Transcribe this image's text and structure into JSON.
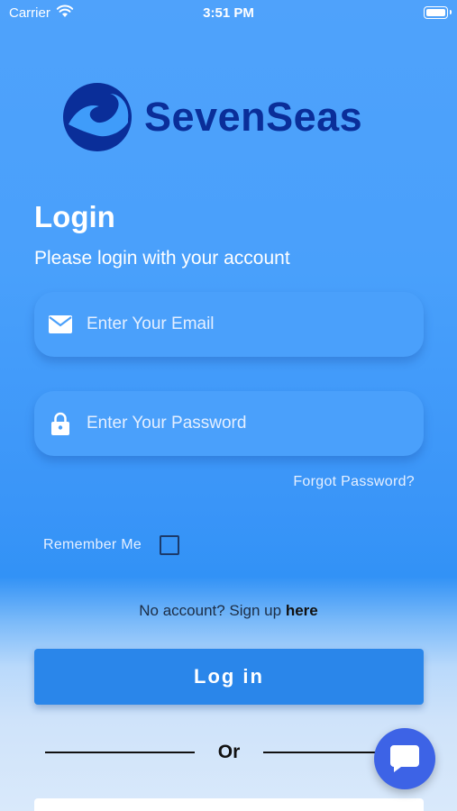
{
  "status_bar": {
    "carrier": "Carrier",
    "time": "3:51 PM"
  },
  "logo": {
    "text": "SevenSeas",
    "icon": "wave-logo-icon"
  },
  "login": {
    "title": "Login",
    "subtitle": "Please login with your account",
    "email": {
      "placeholder": "Enter Your Email",
      "value": "",
      "icon": "mail-icon"
    },
    "password": {
      "placeholder": "Enter Your Password",
      "value": "",
      "icon": "lock-icon"
    },
    "forgot_password": "Forgot Password?",
    "remember_me": {
      "label": "Remember Me",
      "checked": false
    },
    "signup_prompt": "No account? Sign up ",
    "signup_link": "here",
    "login_button": "Log in",
    "divider_text": "Or"
  },
  "chat": {
    "icon": "chat-bubble-icon"
  },
  "colors": {
    "brand": "#0a2e99",
    "background": "#4fa2fb",
    "button": "#2a86ea",
    "chat_fab": "#3d63e6"
  }
}
